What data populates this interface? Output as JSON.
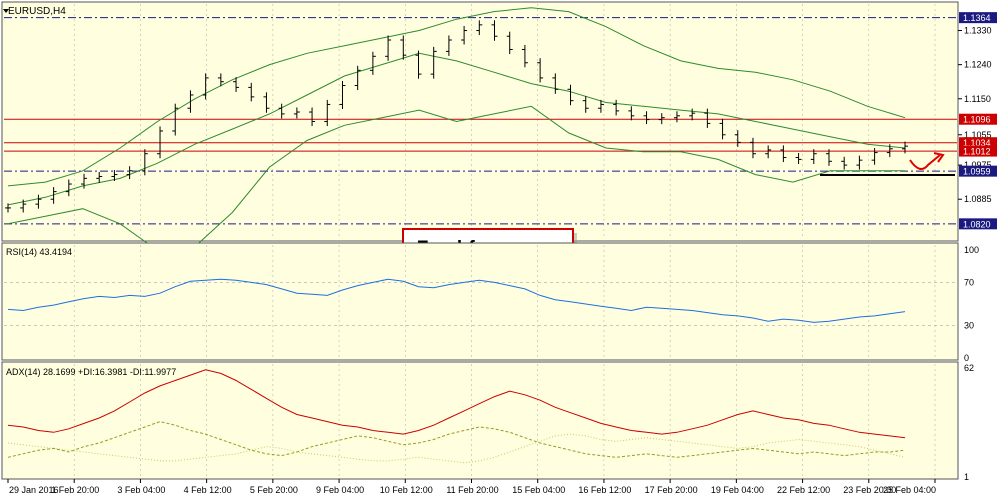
{
  "chart_data": {
    "type": "line",
    "instrument": "EURUSD,H4",
    "x_ticks": [
      "29 Jan 2016",
      "1 Feb 20:00",
      "3 Feb 04:00",
      "4 Feb 12:00",
      "5 Feb 20:00",
      "9 Feb 04:00",
      "10 Feb 12:00",
      "11 Feb 20:00",
      "15 Feb 04:00",
      "16 Feb 12:00",
      "17 Feb 20:00",
      "19 Feb 04:00",
      "22 Feb 12:00",
      "23 Feb 20:00",
      "25 Feb 04:00"
    ],
    "price_panel": {
      "ylim": [
        1.078,
        1.14
      ],
      "y_ticks": [
        "1.1330",
        "1.1240",
        "1.1150",
        "1.1055",
        "1.0975",
        "1.0885"
      ],
      "levels": [
        {
          "label": "1.1364",
          "value": 1.1364,
          "style": "dash-dot",
          "color": "#1a1a80"
        },
        {
          "label": "1.1096",
          "value": 1.1096,
          "style": "solid",
          "color": "#cc0000"
        },
        {
          "label": "1.1034",
          "value": 1.1034,
          "style": "solid",
          "color": "#cc0000"
        },
        {
          "label": "1.1012",
          "value": 1.1012,
          "style": "solid",
          "color": "#cc0000"
        },
        {
          "label": "1.0959",
          "value": 1.0959,
          "style": "dash-dot",
          "color": "#1a1a80"
        },
        {
          "label": "1.0820",
          "value": 1.082,
          "style": "dash-dot",
          "color": "#1a1a80"
        }
      ],
      "bollinger_upper": [
        1.092,
        1.093,
        1.096,
        1.102,
        1.109,
        1.115,
        1.12,
        1.124,
        1.127,
        1.129,
        1.131,
        1.133,
        1.136,
        1.138,
        1.139,
        1.138,
        1.134,
        1.129,
        1.125,
        1.123,
        1.122,
        1.12,
        1.117,
        1.113,
        1.11
      ],
      "bollinger_middle": [
        1.087,
        1.089,
        1.092,
        1.094,
        1.098,
        1.103,
        1.107,
        1.111,
        1.116,
        1.121,
        1.124,
        1.127,
        1.125,
        1.122,
        1.119,
        1.117,
        1.114,
        1.113,
        1.112,
        1.111,
        1.109,
        1.107,
        1.105,
        1.103,
        1.102
      ],
      "bollinger_lower": [
        1.082,
        1.084,
        1.086,
        1.082,
        1.075,
        1.076,
        1.085,
        1.097,
        1.104,
        1.108,
        1.11,
        1.112,
        1.109,
        1.111,
        1.113,
        1.106,
        1.102,
        1.101,
        1.101,
        1.099,
        1.095,
        1.093,
        1.096,
        1.096,
        1.096
      ],
      "close": [
        1.0862,
        1.0872,
        1.0885,
        1.0905,
        1.0925,
        1.094,
        1.0945,
        1.095,
        1.096,
        1.1005,
        1.1065,
        1.1125,
        1.116,
        1.1205,
        1.1195,
        1.118,
        1.1155,
        1.1125,
        1.111,
        1.1115,
        1.109,
        1.1135,
        1.1185,
        1.1225,
        1.1262,
        1.1305,
        1.1265,
        1.1215,
        1.1275,
        1.1305,
        1.133,
        1.1345,
        1.1315,
        1.128,
        1.1245,
        1.1205,
        1.1175,
        1.1145,
        1.1125,
        1.1135,
        1.1118,
        1.1105,
        1.1095,
        1.11,
        1.1105,
        1.1112,
        1.1085,
        1.1055,
        1.1035,
        1.1005,
        1.1015,
        1.0995,
        1.099,
        1.1005,
        1.0985,
        1.0975,
        1.0988,
        1.1008,
        1.1018,
        1.1025
      ]
    },
    "rsi_panel": {
      "label": "RSI(14) 43.4194",
      "y_ticks": [
        "100",
        "70",
        "30",
        "0"
      ],
      "levels": [
        70,
        30
      ],
      "values": [
        45,
        44,
        47,
        49,
        52,
        55,
        57,
        56,
        58,
        57,
        60,
        66,
        71,
        72,
        73,
        72,
        70,
        68,
        64,
        60,
        59,
        58,
        63,
        67,
        70,
        73,
        71,
        66,
        65,
        68,
        70,
        72,
        70,
        67,
        64,
        58,
        54,
        52,
        50,
        48,
        46,
        44,
        47,
        46,
        45,
        44,
        42,
        40,
        39,
        37,
        34,
        36,
        35,
        33,
        34,
        36,
        38,
        39,
        41,
        43
      ]
    },
    "adx_panel": {
      "label": "ADX(14) 28.1699 +DI:16.3981 -DI:11.9977",
      "y_ticks": [
        "62",
        "1"
      ],
      "adx": [
        30,
        29,
        27,
        26,
        28,
        31,
        34,
        38,
        43,
        48,
        52,
        55,
        58,
        61,
        59,
        55,
        50,
        45,
        40,
        36,
        34,
        32,
        30,
        29,
        27,
        26,
        25,
        27,
        30,
        34,
        38,
        42,
        46,
        49,
        47,
        44,
        40,
        37,
        34,
        31,
        29,
        27,
        26,
        25,
        26,
        28,
        30,
        33,
        36,
        38,
        36,
        34,
        33,
        31,
        30,
        28,
        26,
        25,
        24,
        23
      ],
      "plus_di": [
        12,
        14,
        16,
        17,
        15,
        18,
        20,
        23,
        26,
        29,
        32,
        30,
        27,
        25,
        22,
        19,
        16,
        14,
        13,
        15,
        18,
        20,
        22,
        24,
        23,
        21,
        19,
        20,
        22,
        25,
        27,
        29,
        28,
        26,
        23,
        20,
        18,
        16,
        14,
        13,
        12,
        13,
        14,
        13,
        12,
        13,
        14,
        15,
        16,
        17,
        16,
        15,
        14,
        15,
        14,
        13,
        14,
        15,
        15,
        16
      ],
      "minus_di": [
        20,
        19,
        18,
        17,
        16,
        15,
        14,
        13,
        12,
        11,
        10,
        10,
        11,
        12,
        13,
        14,
        16,
        18,
        17,
        15,
        14,
        13,
        12,
        11,
        10,
        10,
        11,
        12,
        11,
        10,
        9,
        10,
        12,
        15,
        18,
        21,
        24,
        25,
        24,
        22,
        21,
        22,
        23,
        22,
        21,
        20,
        19,
        18,
        17,
        18,
        20,
        21,
        22,
        21,
        20,
        19,
        18,
        16,
        14,
        12
      ]
    }
  },
  "watermark": "Freshforex.com",
  "colors": {
    "background": "#ffffe0",
    "border": "#555555",
    "grid": "#b5b5b5",
    "bollinger": "#2e8b2e",
    "bars": "#000000",
    "rsi": "#1e6fe0",
    "adx": "#cc0000",
    "plus_di": "#9a9a20",
    "minus_di": "#c8c866",
    "level_blue": "#1a1a80",
    "level_red": "#cc0000",
    "label_bg": "#1a1a80",
    "label_red_bg": "#cc0000",
    "arrow": "#e00000"
  }
}
